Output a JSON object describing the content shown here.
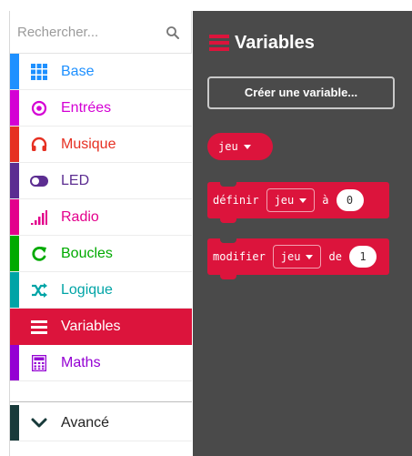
{
  "search": {
    "placeholder": "Rechercher..."
  },
  "categories": [
    {
      "label": "Base",
      "color": "#1e90ff",
      "icon": "grid-icon"
    },
    {
      "label": "Entrées",
      "color": "#d400d4",
      "icon": "target-icon"
    },
    {
      "label": "Musique",
      "color": "#e63022",
      "icon": "headphones-icon"
    },
    {
      "label": "LED",
      "color": "#5c2d91",
      "icon": "toggle-icon"
    },
    {
      "label": "Radio",
      "color": "#e3008c",
      "icon": "signal-bars-icon"
    },
    {
      "label": "Boucles",
      "color": "#00aa00",
      "icon": "refresh-icon"
    },
    {
      "label": "Logique",
      "color": "#00a4a6",
      "icon": "shuffle-icon"
    },
    {
      "label": "Variables",
      "color": "#dc143c",
      "icon": "list-icon"
    },
    {
      "label": "Maths",
      "color": "#9400d3",
      "icon": "calculator-icon"
    }
  ],
  "advanced": {
    "label": "Avancé",
    "icon": "chevron-down-icon",
    "color": "#183a3a"
  },
  "flyout": {
    "title": "Variables",
    "create_button": "Créer une variable...",
    "var_block": {
      "name": "jeu"
    },
    "set_block": {
      "prefix": "définir",
      "var": "jeu",
      "mid": "à",
      "value": "0"
    },
    "change_block": {
      "prefix": "modifier",
      "var": "jeu",
      "mid": "de",
      "value": "1"
    }
  },
  "colors": {
    "active": "#dc143c",
    "flyout_bg": "#4a4a4a"
  }
}
